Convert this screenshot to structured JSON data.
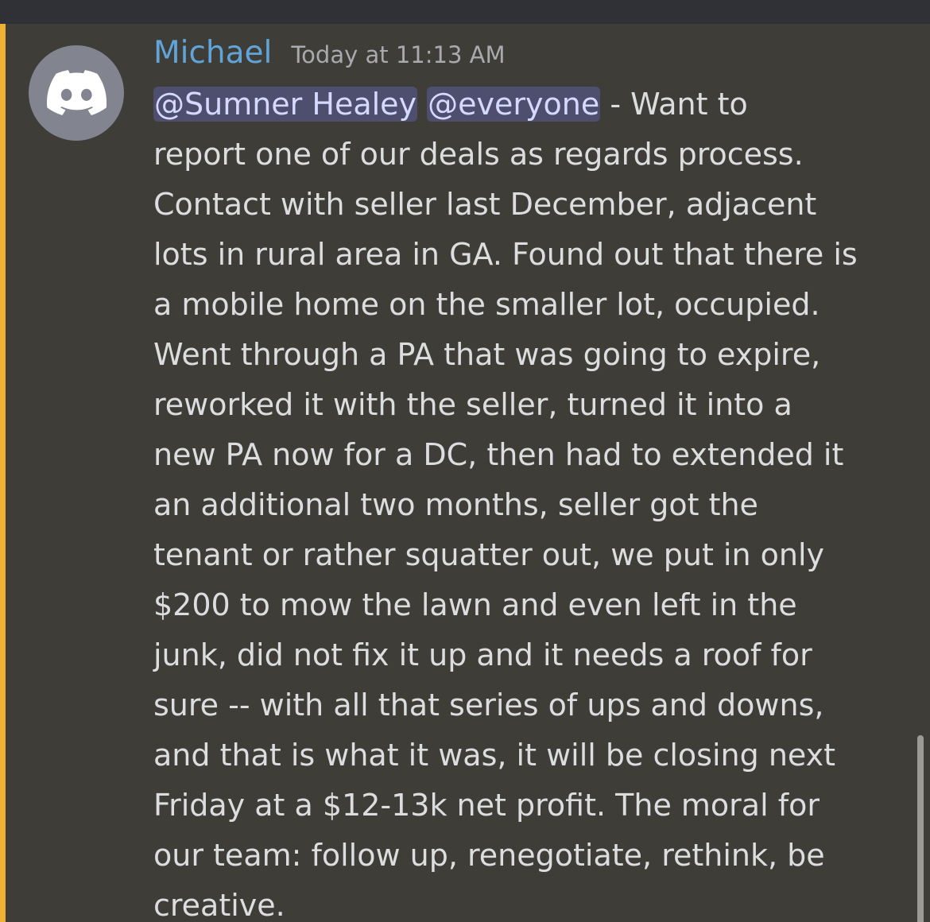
{
  "message": {
    "author": "Michael",
    "timestamp": "Today at 11:13 AM",
    "avatar_icon": "discord-logo-icon",
    "mentions": [
      "@Sumner Healey",
      "@everyone"
    ],
    "lines": [
      " - Want to",
      "report one of our deals as regards process.",
      "Contact with seller last December, adjacent",
      "lots in rural area in GA. Found out that there is",
      "a mobile home on the smaller lot, occupied.",
      "Went through a PA that was going to expire,",
      "reworked it with the seller, turned it into a",
      "new PA now for a DC, then had to extended it",
      "an additional two months, seller got the",
      "tenant or rather squatter out, we put in only",
      "$200 to mow the lawn and even left in the",
      "junk, did not fix it up and it needs a roof for",
      "sure -- with all that series of ups and downs,",
      "and that is what it was, it will be closing next",
      "Friday at a $12-13k net profit. The moral for",
      "our team: follow up, renegotiate, rethink, be",
      "creative."
    ]
  },
  "colors": {
    "background": "#3f3d38",
    "highlight_bar": "#f0b232",
    "author": "#60a4d8",
    "mention_bg": "#4e4f6e",
    "mention_text": "#d5d9ff"
  }
}
